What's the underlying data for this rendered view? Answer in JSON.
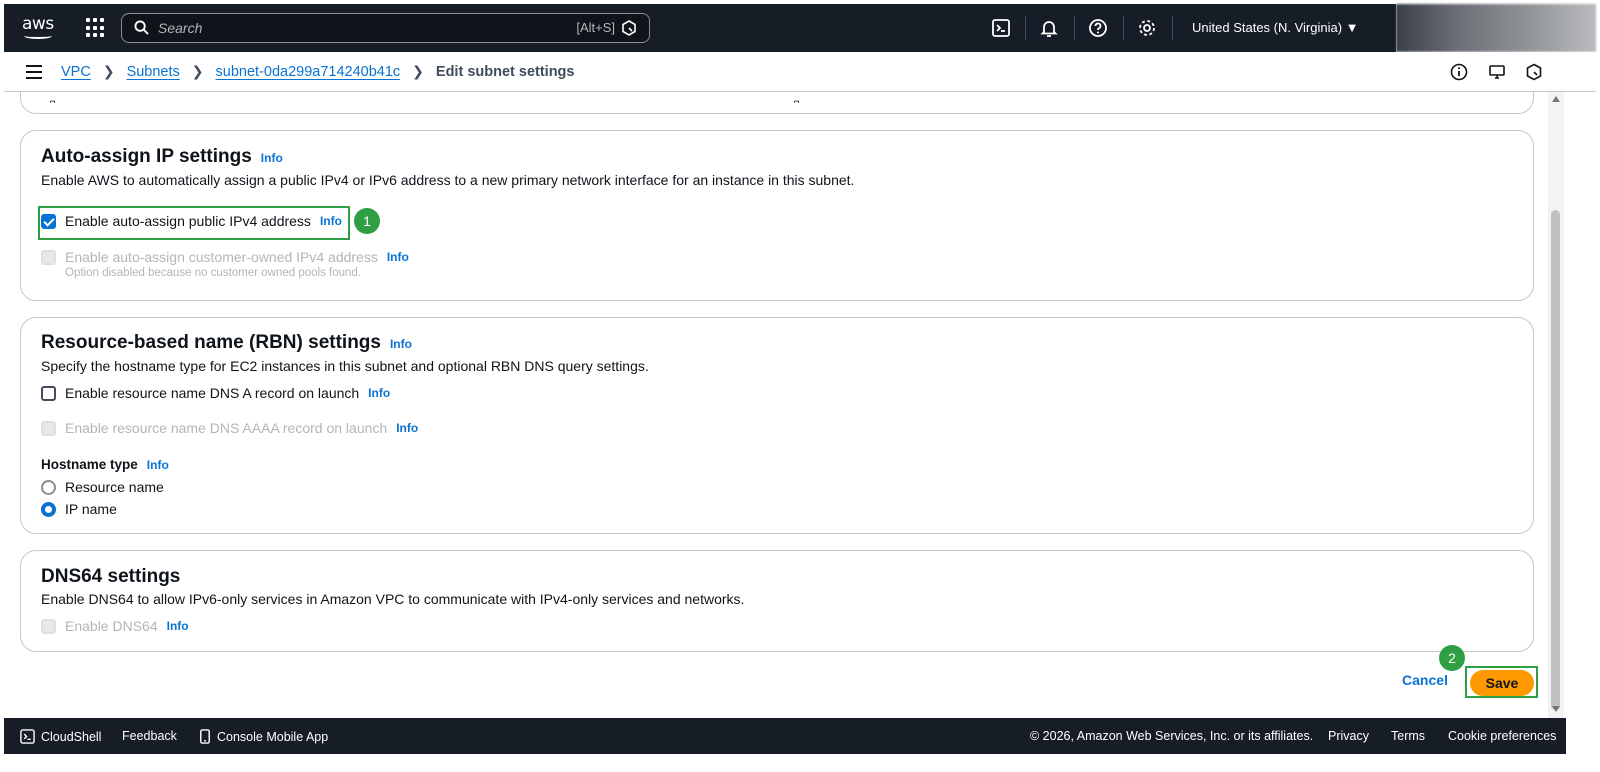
{
  "topnav": {
    "logo_text": "aws",
    "search_placeholder": "Search",
    "search_shortcut": "[Alt+S]",
    "region_label": "United States (N. Virginia) ▼"
  },
  "breadcrumb": {
    "items": [
      "VPC",
      "Subnets",
      "subnet-0da299a714240b41c"
    ],
    "current": "Edit subnet settings"
  },
  "auto_assign": {
    "title": "Auto-assign IP settings",
    "info": "Info",
    "description": "Enable AWS to automatically assign a public IPv4 or IPv6 address to a new primary network interface for an instance in this subnet.",
    "ipv4_label": "Enable auto-assign public IPv4 address",
    "ipv4_checked": true,
    "customer_owned_label": "Enable auto-assign customer-owned IPv4 address",
    "customer_owned_note": "Option disabled because no customer owned pools found."
  },
  "rbn": {
    "title": "Resource-based name (RBN) settings",
    "info": "Info",
    "description": "Specify the hostname type for EC2 instances in this subnet and optional RBN DNS query settings.",
    "dns_a_label": "Enable resource name DNS A record on launch",
    "dns_aaaa_label": "Enable resource name DNS AAAA record on launch",
    "hostname_type_label": "Hostname type",
    "radio_resource_name": "Resource name",
    "radio_ip_name": "IP name",
    "selected": "IP name"
  },
  "dns64": {
    "title": "DNS64 settings",
    "description": "Enable DNS64 to allow IPv6-only services in Amazon VPC to communicate with IPv4-only services and networks.",
    "enable_label": "Enable DNS64",
    "info": "Info"
  },
  "actions": {
    "cancel": "Cancel",
    "save": "Save"
  },
  "annotations": {
    "step1": "1",
    "step2": "2"
  },
  "footer": {
    "cloudshell": "CloudShell",
    "feedback": "Feedback",
    "mobile_app": "Console Mobile App",
    "copyright": "© 2026, Amazon Web Services, Inc. or its affiliates.",
    "privacy": "Privacy",
    "terms": "Terms",
    "cookies": "Cookie preferences"
  },
  "colors": {
    "nav_bg": "#161d26",
    "link": "#0972d3",
    "primary_button": "#ff9900",
    "highlight": "#2ea043"
  }
}
